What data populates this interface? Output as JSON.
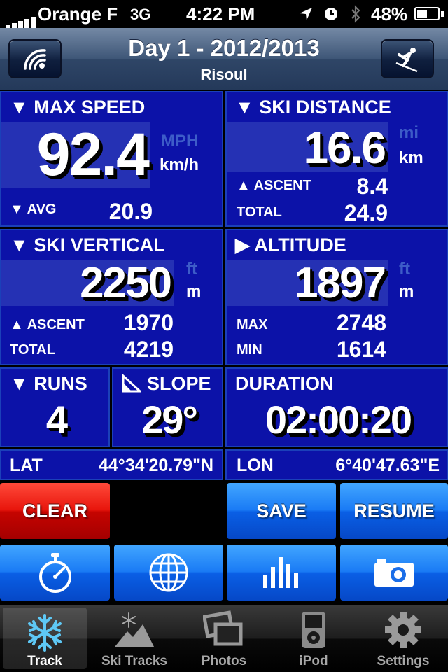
{
  "status": {
    "carrier": "Orange F",
    "network": "3G",
    "time": "4:22 PM",
    "battery": "48%"
  },
  "nav": {
    "title": "Day 1 - 2012/2013",
    "subtitle": "Risoul",
    "left_icon": "signal-waves-icon",
    "right_icon": "skier-icon"
  },
  "max_speed": {
    "title": "▼ MAX SPEED",
    "value": "92.4",
    "unit_alt": "MPH",
    "unit": "km/h",
    "avg_label": "▼ AVG",
    "avg_value": "20.9"
  },
  "ski_distance": {
    "title": "▼ SKI DISTANCE",
    "value": "16.6",
    "unit_alt": "mi",
    "unit": "km",
    "ascent_label": "▲ ASCENT",
    "ascent_value": "8.4",
    "total_label": "TOTAL",
    "total_value": "24.9"
  },
  "ski_vertical": {
    "title": "▼ SKI VERTICAL",
    "value": "2250",
    "unit_alt": "ft",
    "unit": "m",
    "ascent_label": "▲ ASCENT",
    "ascent_value": "1970",
    "total_label": "TOTAL",
    "total_value": "4219"
  },
  "altitude": {
    "title": "▶ ALTITUDE",
    "value": "1897",
    "unit_alt": "ft",
    "unit": "m",
    "max_label": "MAX",
    "max_value": "2748",
    "min_label": "MIN",
    "min_value": "1614"
  },
  "runs": {
    "title": "▼ RUNS",
    "value": "4"
  },
  "slope": {
    "title": "SLOPE",
    "value": "29°"
  },
  "duration": {
    "title": "DURATION",
    "value": "02:00:20"
  },
  "lat": {
    "label": "LAT",
    "value": "44°34'20.79\"N"
  },
  "lon": {
    "label": "LON",
    "value": "6°40'47.63\"E"
  },
  "buttons": {
    "clear": "CLEAR",
    "save": "SAVE",
    "resume": "RESUME"
  },
  "tools": [
    "stopwatch-icon",
    "globe-icon",
    "bar-chart-icon",
    "camera-icon"
  ],
  "tabs": [
    {
      "label": "Track",
      "icon": "snowflake-icon",
      "active": true
    },
    {
      "label": "Ski Tracks",
      "icon": "mountain-icon",
      "active": false
    },
    {
      "label": "Photos",
      "icon": "photos-icon",
      "active": false
    },
    {
      "label": "iPod",
      "icon": "ipod-icon",
      "active": false
    },
    {
      "label": "Settings",
      "icon": "gear-icon",
      "active": false
    }
  ],
  "colors": {
    "panel": "#0c12a8",
    "value_box": "#2531b4",
    "clear": "#e8150c",
    "button_blue": "#1a7bf5"
  }
}
